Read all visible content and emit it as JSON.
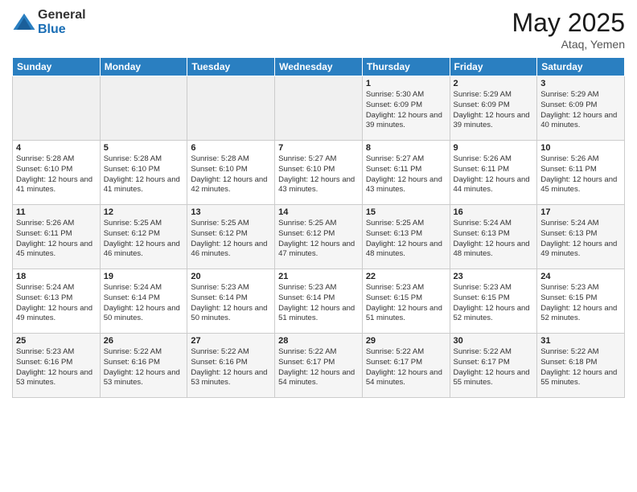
{
  "logo": {
    "general": "General",
    "blue": "Blue"
  },
  "title": "May 2025",
  "location": "Ataq, Yemen",
  "days_of_week": [
    "Sunday",
    "Monday",
    "Tuesday",
    "Wednesday",
    "Thursday",
    "Friday",
    "Saturday"
  ],
  "weeks": [
    [
      {
        "day": "",
        "info": ""
      },
      {
        "day": "",
        "info": ""
      },
      {
        "day": "",
        "info": ""
      },
      {
        "day": "",
        "info": ""
      },
      {
        "day": "1",
        "info": "Sunrise: 5:30 AM\nSunset: 6:09 PM\nDaylight: 12 hours\nand 39 minutes."
      },
      {
        "day": "2",
        "info": "Sunrise: 5:29 AM\nSunset: 6:09 PM\nDaylight: 12 hours\nand 39 minutes."
      },
      {
        "day": "3",
        "info": "Sunrise: 5:29 AM\nSunset: 6:09 PM\nDaylight: 12 hours\nand 40 minutes."
      }
    ],
    [
      {
        "day": "4",
        "info": "Sunrise: 5:28 AM\nSunset: 6:10 PM\nDaylight: 12 hours\nand 41 minutes."
      },
      {
        "day": "5",
        "info": "Sunrise: 5:28 AM\nSunset: 6:10 PM\nDaylight: 12 hours\nand 41 minutes."
      },
      {
        "day": "6",
        "info": "Sunrise: 5:28 AM\nSunset: 6:10 PM\nDaylight: 12 hours\nand 42 minutes."
      },
      {
        "day": "7",
        "info": "Sunrise: 5:27 AM\nSunset: 6:10 PM\nDaylight: 12 hours\nand 43 minutes."
      },
      {
        "day": "8",
        "info": "Sunrise: 5:27 AM\nSunset: 6:11 PM\nDaylight: 12 hours\nand 43 minutes."
      },
      {
        "day": "9",
        "info": "Sunrise: 5:26 AM\nSunset: 6:11 PM\nDaylight: 12 hours\nand 44 minutes."
      },
      {
        "day": "10",
        "info": "Sunrise: 5:26 AM\nSunset: 6:11 PM\nDaylight: 12 hours\nand 45 minutes."
      }
    ],
    [
      {
        "day": "11",
        "info": "Sunrise: 5:26 AM\nSunset: 6:11 PM\nDaylight: 12 hours\nand 45 minutes."
      },
      {
        "day": "12",
        "info": "Sunrise: 5:25 AM\nSunset: 6:12 PM\nDaylight: 12 hours\nand 46 minutes."
      },
      {
        "day": "13",
        "info": "Sunrise: 5:25 AM\nSunset: 6:12 PM\nDaylight: 12 hours\nand 46 minutes."
      },
      {
        "day": "14",
        "info": "Sunrise: 5:25 AM\nSunset: 6:12 PM\nDaylight: 12 hours\nand 47 minutes."
      },
      {
        "day": "15",
        "info": "Sunrise: 5:25 AM\nSunset: 6:13 PM\nDaylight: 12 hours\nand 48 minutes."
      },
      {
        "day": "16",
        "info": "Sunrise: 5:24 AM\nSunset: 6:13 PM\nDaylight: 12 hours\nand 48 minutes."
      },
      {
        "day": "17",
        "info": "Sunrise: 5:24 AM\nSunset: 6:13 PM\nDaylight: 12 hours\nand 49 minutes."
      }
    ],
    [
      {
        "day": "18",
        "info": "Sunrise: 5:24 AM\nSunset: 6:13 PM\nDaylight: 12 hours\nand 49 minutes."
      },
      {
        "day": "19",
        "info": "Sunrise: 5:24 AM\nSunset: 6:14 PM\nDaylight: 12 hours\nand 50 minutes."
      },
      {
        "day": "20",
        "info": "Sunrise: 5:23 AM\nSunset: 6:14 PM\nDaylight: 12 hours\nand 50 minutes."
      },
      {
        "day": "21",
        "info": "Sunrise: 5:23 AM\nSunset: 6:14 PM\nDaylight: 12 hours\nand 51 minutes."
      },
      {
        "day": "22",
        "info": "Sunrise: 5:23 AM\nSunset: 6:15 PM\nDaylight: 12 hours\nand 51 minutes."
      },
      {
        "day": "23",
        "info": "Sunrise: 5:23 AM\nSunset: 6:15 PM\nDaylight: 12 hours\nand 52 minutes."
      },
      {
        "day": "24",
        "info": "Sunrise: 5:23 AM\nSunset: 6:15 PM\nDaylight: 12 hours\nand 52 minutes."
      }
    ],
    [
      {
        "day": "25",
        "info": "Sunrise: 5:23 AM\nSunset: 6:16 PM\nDaylight: 12 hours\nand 53 minutes."
      },
      {
        "day": "26",
        "info": "Sunrise: 5:22 AM\nSunset: 6:16 PM\nDaylight: 12 hours\nand 53 minutes."
      },
      {
        "day": "27",
        "info": "Sunrise: 5:22 AM\nSunset: 6:16 PM\nDaylight: 12 hours\nand 53 minutes."
      },
      {
        "day": "28",
        "info": "Sunrise: 5:22 AM\nSunset: 6:17 PM\nDaylight: 12 hours\nand 54 minutes."
      },
      {
        "day": "29",
        "info": "Sunrise: 5:22 AM\nSunset: 6:17 PM\nDaylight: 12 hours\nand 54 minutes."
      },
      {
        "day": "30",
        "info": "Sunrise: 5:22 AM\nSunset: 6:17 PM\nDaylight: 12 hours\nand 55 minutes."
      },
      {
        "day": "31",
        "info": "Sunrise: 5:22 AM\nSunset: 6:18 PM\nDaylight: 12 hours\nand 55 minutes."
      }
    ]
  ]
}
